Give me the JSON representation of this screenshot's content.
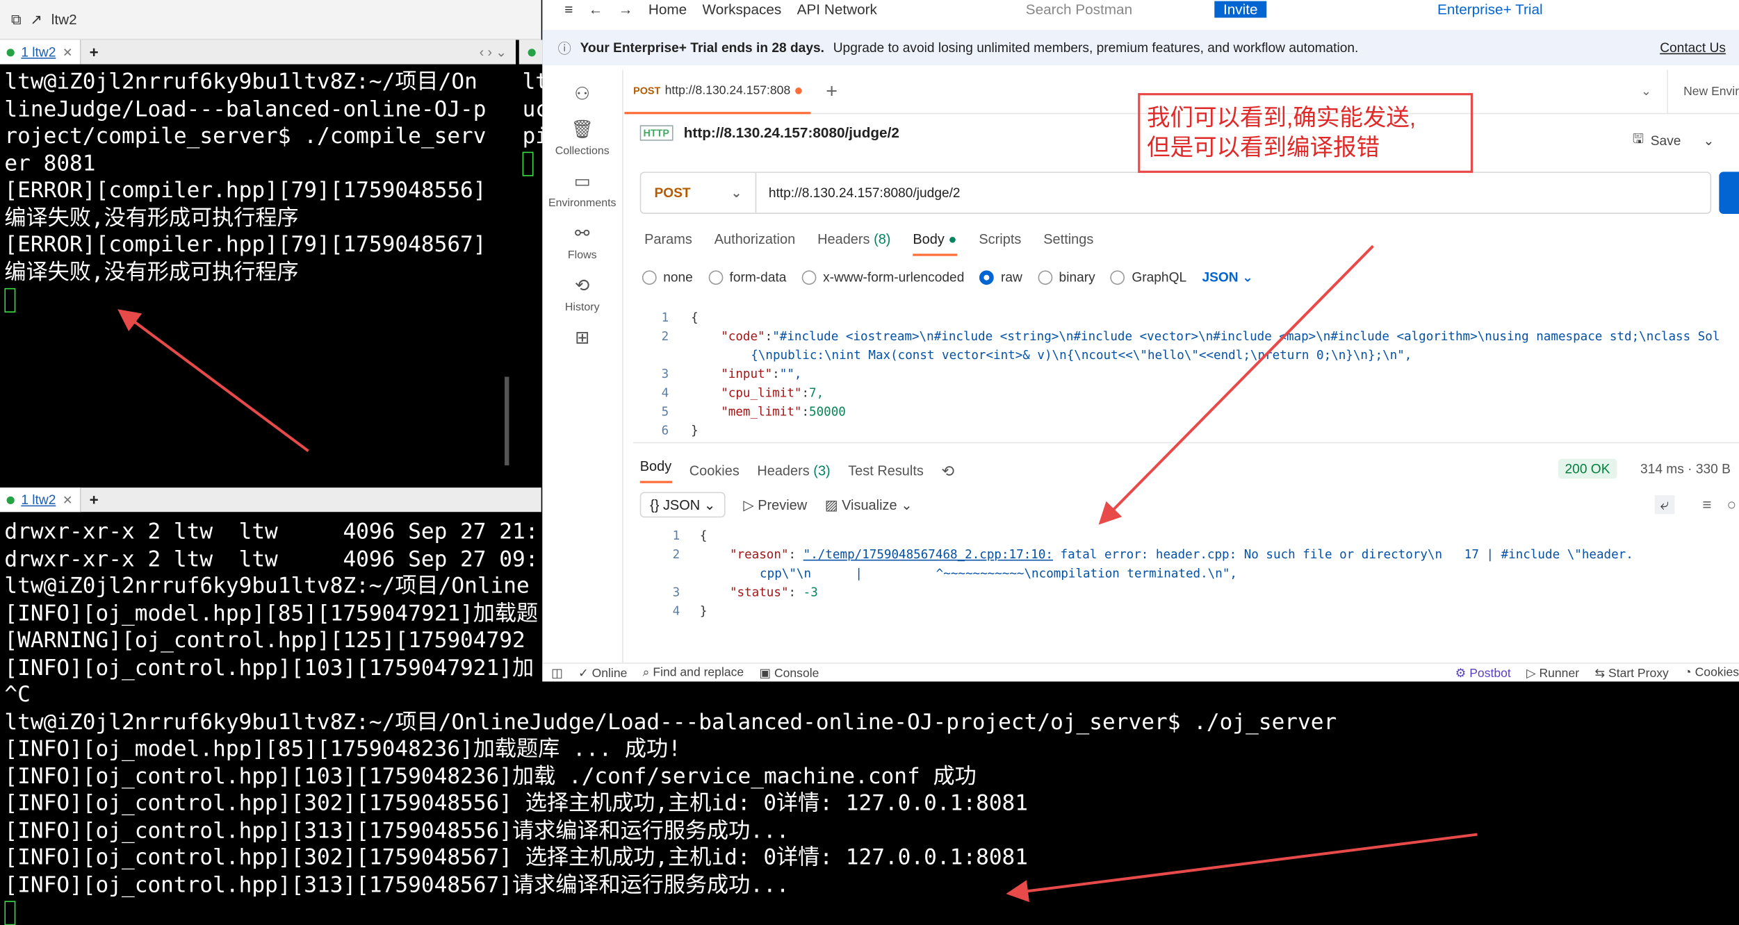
{
  "top_window": {
    "title": "ltw2"
  },
  "left_term": {
    "tab_label": "1 ltw2",
    "lines": [
      "ltw@iZ0jl2nrruf6ky9bu1ltv8Z:~/项目/On",
      "lineJudge/Load---balanced-online-OJ-p",
      "roject/compile_server$ ./compile_serv",
      "er 8081",
      "[ERROR][compiler.hpp][79][1759048556]",
      "编译失败,没有形成可执行程序",
      "[ERROR][compiler.hpp][79][1759048567]",
      "编译失败,没有形成可执行程序"
    ]
  },
  "mid_term": {
    "lines": [
      "lt",
      "uc",
      "pi"
    ]
  },
  "bottom_term": {
    "tab_label": "1 ltw2",
    "lines": [
      "drwxr-xr-x 2 ltw  ltw     4096 Sep 27 21:",
      "drwxr-xr-x 2 ltw  ltw     4096 Sep 27 09:",
      "ltw@iZ0jl2nrruf6ky9bu1ltv8Z:~/项目/Online",
      "[INFO][oj_model.hpp][85][1759047921]加载题",
      "[WARNING][oj_control.hpp][125][175904792",
      "[INFO][oj_control.hpp][103][1759047921]加",
      "^C",
      "ltw@iZ0jl2nrruf6ky9bu1ltv8Z:~/项目/OnlineJudge/Load---balanced-online-OJ-project/oj_server$ ./oj_server",
      "[INFO][oj_model.hpp][85][1759048236]加载题库 ... 成功!",
      "[INFO][oj_control.hpp][103][1759048236]加载 ./conf/service_machine.conf 成功",
      "[INFO][oj_control.hpp][302][1759048556] 选择主机成功,主机id: 0详情: 127.0.0.1:8081",
      "[INFO][oj_control.hpp][313][1759048556]请求编译和运行服务成功...",
      "[INFO][oj_control.hpp][302][1759048567] 选择主机成功,主机id: 0详情: 127.0.0.1:8081",
      "[INFO][oj_control.hpp][313][1759048567]请求编译和运行服务成功..."
    ]
  },
  "postman": {
    "nav": {
      "home": "Home",
      "workspaces": "Workspaces",
      "api_network": "API Network",
      "search": "Search Postman",
      "invite": "Invite",
      "trial": "Enterprise+ Trial"
    },
    "banner": {
      "bold": "Your Enterprise+ Trial ends in 28 days.",
      "text": "Upgrade to avoid losing unlimited members, premium features, and workflow automation.",
      "link": "Contact Us"
    },
    "sidebar": [
      {
        "label": "",
        "icon": "team-icon"
      },
      {
        "label": "Collections",
        "icon": "trash-icon"
      },
      {
        "label": "Environments",
        "icon": "env-icon"
      },
      {
        "label": "Flows",
        "icon": "flows-icon"
      },
      {
        "label": "History",
        "icon": "history-icon"
      }
    ],
    "tab": {
      "method": "POST",
      "url": "http://8.130.24.157:808"
    },
    "env": "New Envir",
    "title": "http://8.130.24.157:8080/judge/2",
    "save": "Save",
    "method": "POST",
    "url": "http://8.130.24.157:8080/judge/2",
    "subtabs": {
      "params": "Params",
      "auth": "Authorization",
      "headers": "Headers",
      "headers_count": "(8)",
      "body": "Body",
      "scripts": "Scripts",
      "settings": "Settings"
    },
    "body_types": {
      "none": "none",
      "form": "form-data",
      "urlenc": "x-www-form-urlencoded",
      "raw": "raw",
      "binary": "binary",
      "graphql": "GraphQL",
      "json": "JSON"
    },
    "request_body": {
      "code_key": "\"code\"",
      "code_val1": "\"#include <iostream>\\n#include <string>\\n#include <vector>\\n#include <map>\\n#include <algorithm>\\nusing namespace std;\\nclass Sol",
      "code_val2": "{\\npublic:\\nint Max(const vector<int>& v)\\n{\\ncout<<\\\"hello\\\"<<endl;\\nreturn 0;\\n}\\n};\\n\",",
      "input_key": "\"input\"",
      "input_val": "\"\",",
      "cpu_key": "\"cpu_limit\"",
      "cpu_val": "7,",
      "mem_key": "\"mem_limit\"",
      "mem_val": "50000"
    },
    "resp_tabs": {
      "body": "Body",
      "cookies": "Cookies",
      "headers": "Headers",
      "headers_count": "(3)",
      "tests": "Test Results"
    },
    "status": "200 OK",
    "time": "314 ms",
    "size": "330 B",
    "fmt": {
      "json": "JSON",
      "preview": "Preview",
      "visualize": "Visualize"
    },
    "response": {
      "reason_key": "\"reason\"",
      "reason_link": "\"./temp/1759048567468_2.cpp:17:10:",
      "reason_rest": " fatal error: header.cpp: No such file or directory\\n   17 | #include \\\"header.",
      "reason_line2": "cpp\\\"\\n      |          ^~~~~~~~~~~~\\ncompilation terminated.\\n\",",
      "status_key": "\"status\"",
      "status_val": "-3"
    },
    "statusbar": {
      "online": "Online",
      "find": "Find and replace",
      "console": "Console",
      "postbot": "Postbot",
      "runner": "Runner",
      "proxy": "Start Proxy",
      "cookies": "Cookies"
    }
  },
  "annotation": {
    "line1": "我们可以看到,确实能发送,",
    "line2": "但是可以看到编译报错"
  }
}
